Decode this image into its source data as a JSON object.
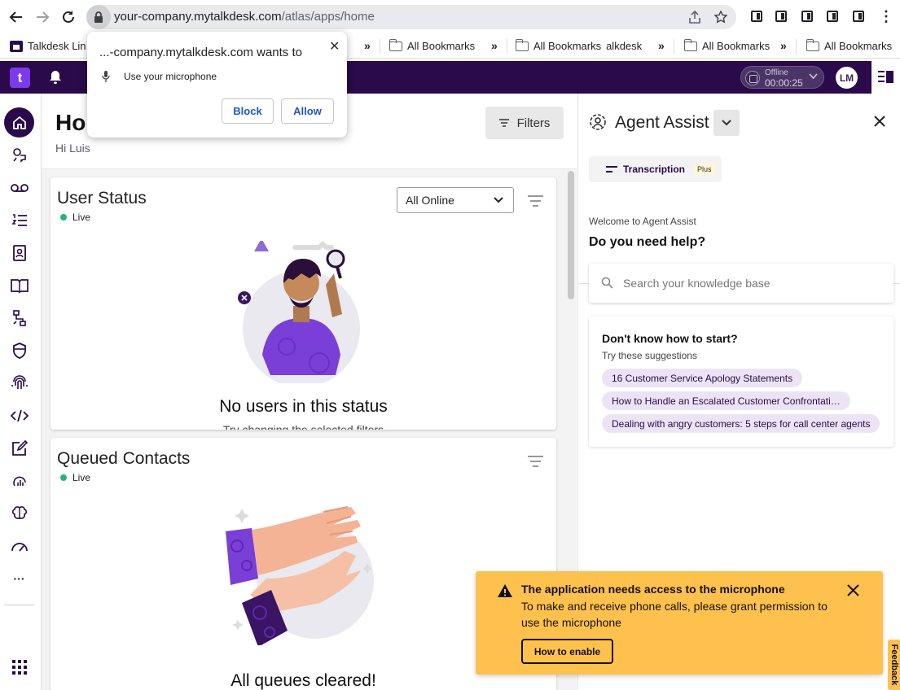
{
  "browser": {
    "url_host": "your-company.mytalkdesk.com",
    "url_path": "/atlas/apps/home",
    "bookmarks": [
      {
        "label": "Talkdesk Lin"
      },
      {
        "label": "All Bookmarks"
      },
      {
        "label": "All Bookmarks"
      },
      {
        "label": "alkdesk"
      },
      {
        "label": "All Bookmarks"
      },
      {
        "label": "All Bookmarks"
      }
    ]
  },
  "permission_prompt": {
    "title": "...-company.mytalkdesk.com wants to",
    "item": "Use your microphone",
    "block_label": "Block",
    "allow_label": "Allow"
  },
  "appbar": {
    "logo": "t",
    "status_label": "Offline",
    "status_time": "00:00:25",
    "avatar_initials": "LM"
  },
  "home": {
    "title": "Home",
    "greeting": "Hi Luis",
    "filters_label": "Filters"
  },
  "user_status": {
    "title": "User Status",
    "live_label": "Live",
    "select_value": "All Online",
    "empty_title": "No users in this status",
    "empty_sub": "Try changing the selected filters"
  },
  "queued": {
    "title": "Queued Contacts",
    "live_label": "Live",
    "empty_title": "All queues cleared!"
  },
  "assist": {
    "title": "Agent Assist",
    "transcription_label": "Transcription",
    "plus_badge": "Plus",
    "welcome": "Welcome to Agent Assist",
    "need_help": "Do you need help?",
    "search_placeholder": "Search your knowledge base",
    "suggest_title": "Don't know how to start?",
    "suggest_sub": "Try these suggestions",
    "suggestions": [
      "16 Customer Service Apology Statements",
      "How to Handle an Escalated Customer Confrontation",
      "Dealing with angry customers: 5 steps for call center agents"
    ]
  },
  "toast": {
    "title": "The application needs access to the microphone",
    "body": "To make and receive phone calls, please grant permission to use the microphone",
    "button_label": "How to enable"
  },
  "feedback_label": "Feedback",
  "colors": {
    "brand_dark": "#2a0a4a",
    "brand_accent": "#7c3aed",
    "live_green": "#22b573",
    "toast_yellow": "#ffc14d",
    "chip_bg": "#ece4f5"
  }
}
